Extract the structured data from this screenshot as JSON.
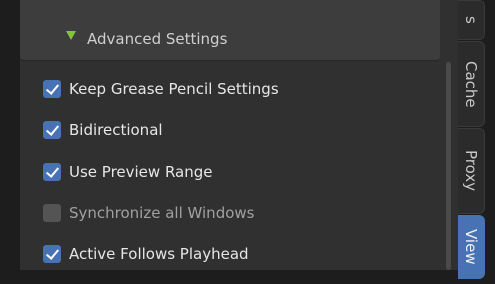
{
  "advanced_settings": {
    "label": "Advanced Settings",
    "expanded": true
  },
  "options": [
    {
      "label": "Keep Grease Pencil Settings",
      "checked": true
    },
    {
      "label": "Bidirectional",
      "checked": true
    },
    {
      "label": "Use Preview Range",
      "checked": true
    },
    {
      "label": "Synchronize all Windows",
      "checked": false
    },
    {
      "label": "Active Follows Playhead",
      "checked": true
    }
  ],
  "tabs": [
    {
      "label": "s",
      "active": false
    },
    {
      "label": "Cache",
      "active": false
    },
    {
      "label": "Proxy",
      "active": false
    },
    {
      "label": "View",
      "active": true
    }
  ],
  "colors": {
    "accent": "#4772b3",
    "triangle": "#82c53c"
  }
}
